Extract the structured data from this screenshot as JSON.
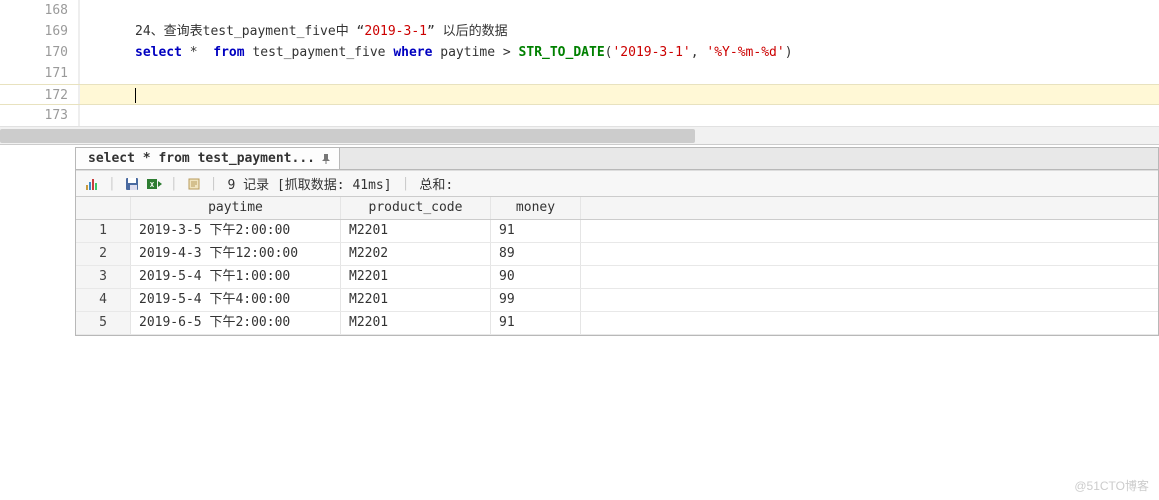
{
  "editor": {
    "lines": [
      "168",
      "169",
      "170",
      "171",
      "172",
      "173"
    ],
    "current_line": "172",
    "comment_line": {
      "prefix": "24、查询表test_payment_five中 “",
      "date": "2019-3-1",
      "suffix": "” 以后的数据"
    },
    "sql": {
      "select": "select",
      "star": " * ",
      "from": " from",
      "table": " test_payment_five ",
      "where": "where",
      "col": " paytime > ",
      "func": "STR_TO_DATE",
      "open": "(",
      "date_str": "'2019-3-1'",
      "comma": ", ",
      "fmt_str": "'%Y-%m-%d'",
      "close": ")"
    }
  },
  "tab": {
    "label": "select *  from test_payment..."
  },
  "toolbar": {
    "status": "9 记录 [抓取数据: 41ms]",
    "total": "总和:"
  },
  "grid": {
    "headers": {
      "rownum": "",
      "paytime": "paytime",
      "product_code": "product_code",
      "money": "money"
    },
    "rows": [
      {
        "n": "1",
        "paytime": "2019-3-5 下午2:00:00",
        "product_code": "M2201",
        "money": "91"
      },
      {
        "n": "2",
        "paytime": "2019-4-3 下午12:00:00",
        "product_code": "M2202",
        "money": "89"
      },
      {
        "n": "3",
        "paytime": "2019-5-4 下午1:00:00",
        "product_code": "M2201",
        "money": "90"
      },
      {
        "n": "4",
        "paytime": "2019-5-4 下午4:00:00",
        "product_code": "M2201",
        "money": "99"
      },
      {
        "n": "5",
        "paytime": "2019-6-5 下午2:00:00",
        "product_code": "M2201",
        "money": "91"
      }
    ]
  },
  "watermark": "@51CTO博客"
}
